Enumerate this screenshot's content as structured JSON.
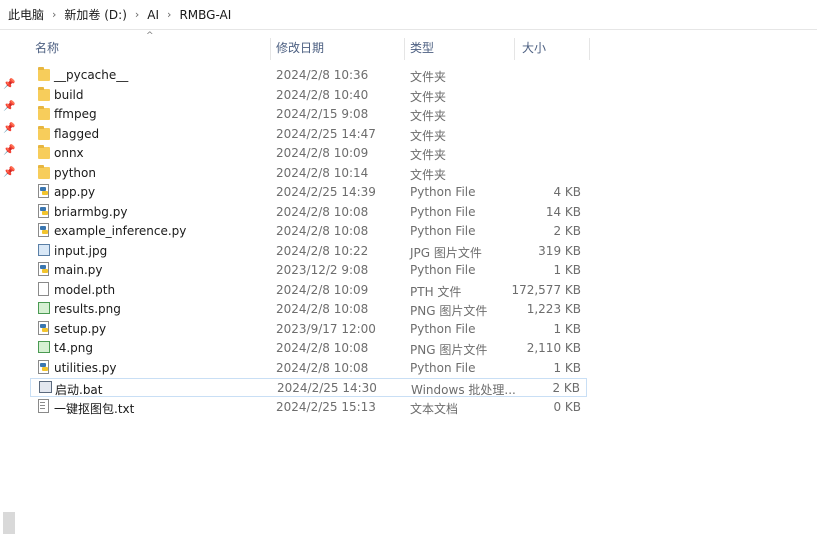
{
  "breadcrumb": [
    "此电脑",
    "新加卷 (D:)",
    "AI",
    "RMBG-AI"
  ],
  "columns": {
    "name": "名称",
    "date": "修改日期",
    "type": "类型",
    "size": "大小"
  },
  "files": [
    {
      "name": "__pycache__",
      "date": "2024/2/8 10:36",
      "type": "文件夹",
      "size": "",
      "icon": "folder-icon"
    },
    {
      "name": "build",
      "date": "2024/2/8 10:40",
      "type": "文件夹",
      "size": "",
      "icon": "folder-icon"
    },
    {
      "name": "ffmpeg",
      "date": "2024/2/15 9:08",
      "type": "文件夹",
      "size": "",
      "icon": "folder-icon"
    },
    {
      "name": "flagged",
      "date": "2024/2/25 14:47",
      "type": "文件夹",
      "size": "",
      "icon": "folder-icon"
    },
    {
      "name": "onnx",
      "date": "2024/2/8 10:09",
      "type": "文件夹",
      "size": "",
      "icon": "folder-icon"
    },
    {
      "name": "python",
      "date": "2024/2/8 10:14",
      "type": "文件夹",
      "size": "",
      "icon": "folder-icon"
    },
    {
      "name": "app.py",
      "date": "2024/2/25 14:39",
      "type": "Python File",
      "size": "4 KB",
      "icon": "python-file-icon"
    },
    {
      "name": "briarmbg.py",
      "date": "2024/2/8 10:08",
      "type": "Python File",
      "size": "14 KB",
      "icon": "python-file-icon"
    },
    {
      "name": "example_inference.py",
      "date": "2024/2/8 10:08",
      "type": "Python File",
      "size": "2 KB",
      "icon": "python-file-icon"
    },
    {
      "name": "input.jpg",
      "date": "2024/2/8 10:22",
      "type": "JPG 图片文件",
      "size": "319 KB",
      "icon": "jpg-image-icon"
    },
    {
      "name": "main.py",
      "date": "2023/12/2 9:08",
      "type": "Python File",
      "size": "1 KB",
      "icon": "python-file-icon"
    },
    {
      "name": "model.pth",
      "date": "2024/2/8 10:09",
      "type": "PTH 文件",
      "size": "172,577 KB",
      "icon": "blank-file-icon"
    },
    {
      "name": "results.png",
      "date": "2024/2/8 10:08",
      "type": "PNG 图片文件",
      "size": "1,223 KB",
      "icon": "png-image-icon"
    },
    {
      "name": "setup.py",
      "date": "2023/9/17 12:00",
      "type": "Python File",
      "size": "1 KB",
      "icon": "python-file-icon"
    },
    {
      "name": "t4.png",
      "date": "2024/2/8 10:08",
      "type": "PNG 图片文件",
      "size": "2,110 KB",
      "icon": "png-image-icon"
    },
    {
      "name": "utilities.py",
      "date": "2024/2/8 10:08",
      "type": "Python File",
      "size": "1 KB",
      "icon": "python-file-icon"
    },
    {
      "name": "启动.bat",
      "date": "2024/2/25 14:30",
      "type": "Windows 批处理...",
      "size": "2 KB",
      "icon": "batch-file-icon",
      "highlighted": true
    },
    {
      "name": "一键抠图包.txt",
      "date": "2024/2/25 15:13",
      "type": "文本文档",
      "size": "0 KB",
      "icon": "text-file-icon"
    }
  ]
}
